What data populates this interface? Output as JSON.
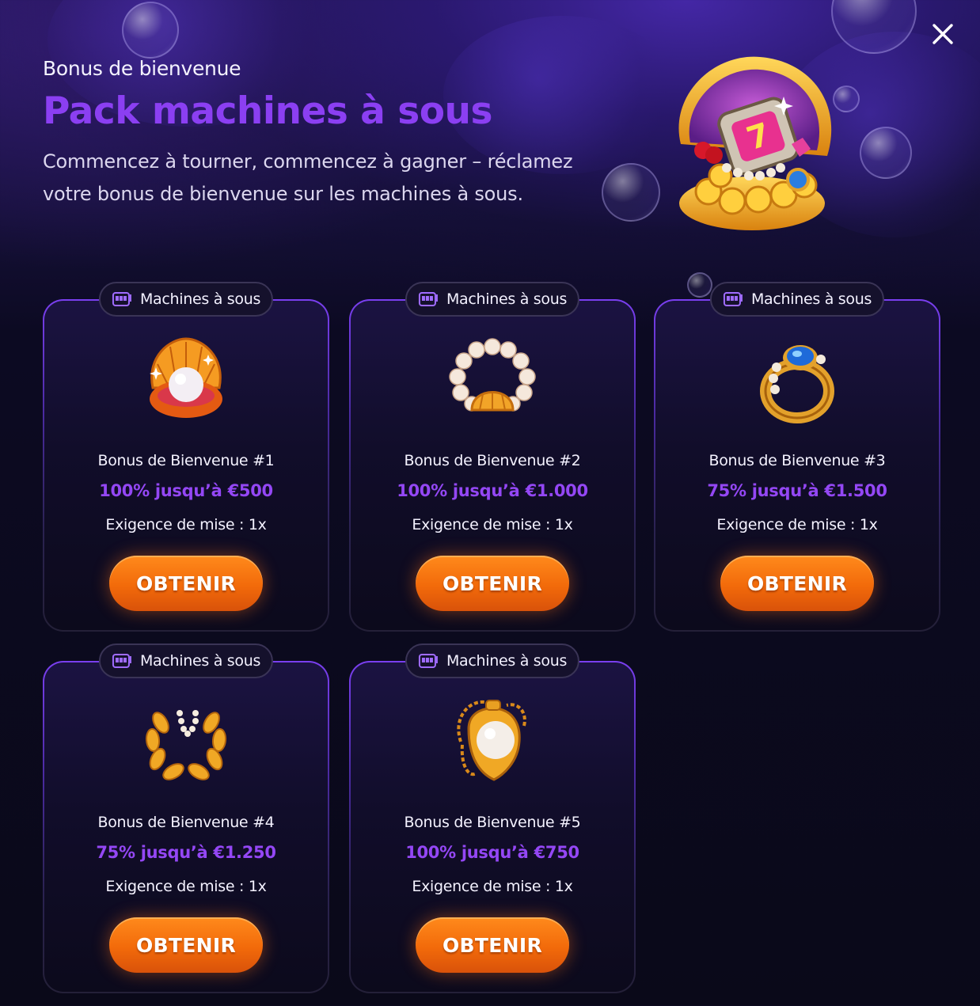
{
  "header": {
    "subtitle": "Bonus de bienvenue",
    "title": "Pack machines à sous",
    "description": "Commencez à tourner, commencez à gagner – réclamez votre bonus de bienvenue sur les machines à sous."
  },
  "close_icon": "close-icon",
  "colors": {
    "accent_purple": "#8b3ff2",
    "button_orange": "#f26a0a",
    "background": "#0c0a22"
  },
  "cards": [
    {
      "category": "Machines à sous",
      "icon": "pearl-shell-icon",
      "name": "Bonus de Bienvenue #1",
      "amount": "100% jusqu’à €500",
      "wager": "Exigence de mise : 1x",
      "button": "OBTENIR"
    },
    {
      "category": "Machines à sous",
      "icon": "pearl-bracelet-icon",
      "name": "Bonus de Bienvenue #2",
      "amount": "100% jusqu’à €1.000",
      "wager": "Exigence de mise : 1x",
      "button": "OBTENIR"
    },
    {
      "category": "Machines à sous",
      "icon": "sapphire-ring-icon",
      "name": "Bonus de Bienvenue #3",
      "amount": "75% jusqu’à €1.500",
      "wager": "Exigence de mise : 1x",
      "button": "OBTENIR"
    },
    {
      "category": "Machines à sous",
      "icon": "laurel-pearl-necklace-icon",
      "name": "Bonus de Bienvenue #4",
      "amount": "75% jusqu’à €1.250",
      "wager": "Exigence de mise : 1x",
      "button": "OBTENIR"
    },
    {
      "category": "Machines à sous",
      "icon": "pearl-pendant-icon",
      "name": "Bonus de Bienvenue #5",
      "amount": "100% jusqu’à €750",
      "wager": "Exigence de mise : 1x",
      "button": "OBTENIR"
    }
  ]
}
